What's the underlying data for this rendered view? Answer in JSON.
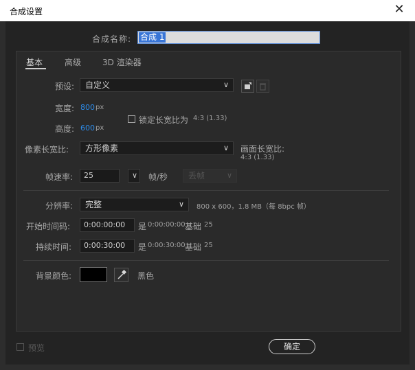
{
  "window": {
    "title": "合成设置",
    "close_icon": "close-icon"
  },
  "comp_name": {
    "label": "合成名称:",
    "value": "合成 1"
  },
  "tabs": [
    {
      "label": "基本",
      "active": true
    },
    {
      "label": "高级",
      "active": false
    },
    {
      "label": "3D 渲染器",
      "active": false
    }
  ],
  "preset": {
    "label": "预设:",
    "value": "自定义"
  },
  "width": {
    "label": "宽度:",
    "value": "800",
    "unit": "px"
  },
  "height": {
    "label": "高度:",
    "value": "600",
    "unit": "px"
  },
  "lock_aspect": {
    "label": "锁定长宽比为",
    "ratio": "4:3 (1.33)",
    "checked": false
  },
  "pixel_aspect": {
    "label": "像素长宽比:",
    "value": "方形像素"
  },
  "frame_aspect": {
    "label": "画面长宽比:",
    "value": "4:3 (1.33)"
  },
  "frame_rate": {
    "label": "帧速率:",
    "value": "25",
    "unit": "帧/秒",
    "drop_frame": "丢帧"
  },
  "resolution": {
    "label": "分辨率:",
    "value": "完整",
    "info": "800 x 600，1.8 MB（每 8bpc 帧）"
  },
  "start_timecode": {
    "label": "开始时间码:",
    "value": "0:00:00:00",
    "is_prefix": "是",
    "equiv": "0:00:00:00",
    "base_label": "基础",
    "base": "25"
  },
  "duration": {
    "label": "持续时间:",
    "value": "0:00:30:00",
    "is_prefix": "是",
    "equiv": "0:00:30:00",
    "base_label": "基础",
    "base": "25"
  },
  "background": {
    "label": "背景颜色:",
    "color": "#000000",
    "color_name": "黑色"
  },
  "footer": {
    "preview_label": "预览",
    "ok_label": "确定"
  }
}
